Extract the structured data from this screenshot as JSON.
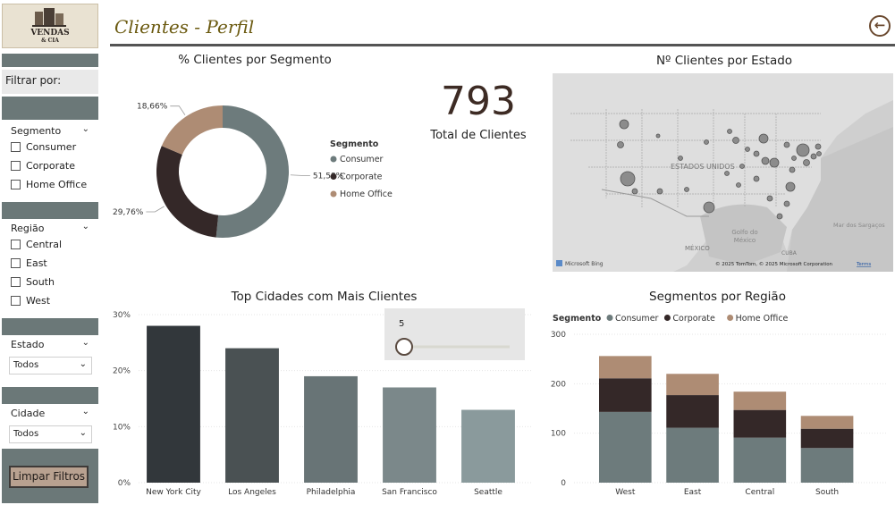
{
  "sidebar": {
    "logo_text_1": "VENDAS",
    "logo_text_2": "& CIA",
    "filter_label": "Filtrar por:",
    "segment_title": "Segmento",
    "segment_options": [
      "Consumer",
      "Corporate",
      "Home Office"
    ],
    "region_title": "Região",
    "region_options": [
      "Central",
      "East",
      "South",
      "West"
    ],
    "state_title": "Estado",
    "state_value": "Todos",
    "city_title": "Cidade",
    "city_value": "Todos",
    "clear_button": "Limpar Filtros"
  },
  "header": {
    "title": "Clientes - Perfil",
    "back_icon": "arrow-left-circle-icon"
  },
  "kpi": {
    "value": "793",
    "label": "Total de Clientes"
  },
  "donut": {
    "title": "% Clientes por Segmento",
    "legend_title": "Segmento"
  },
  "map": {
    "title": "Nº Clientes por Estado",
    "country_label": "ESTADOS UNIDOS",
    "gulf_label_1": "Golfo do",
    "gulf_label_2": "México",
    "mexico_label": "MÉXICO",
    "cuba_label": "CUBA",
    "sea_label": "Mar dos Sargaços",
    "bing_label": "Microsoft Bing",
    "copyright": "© 2025 TomTom, © 2025 Microsoft Corporation",
    "terms": "Terms"
  },
  "top_cities": {
    "title": "Top Cidades com Mais Clientes",
    "slider_value": "5",
    "slider_fraction": 0.0
  },
  "segments_region": {
    "title": "Segmentos por Região",
    "legend_title": "Segmento"
  },
  "colors": {
    "consumer": "#6d7b7c",
    "corporate": "#342828",
    "home_office": "#ae8c74",
    "title": "#6b5a10"
  },
  "chart_data": [
    {
      "type": "pie",
      "title": "% Clientes por Segmento",
      "legend_title": "Segmento",
      "categories": [
        "Consumer",
        "Corporate",
        "Home Office"
      ],
      "values": [
        51.58,
        29.76,
        18.66
      ],
      "labels": [
        "51,58%",
        "29,76%",
        "18,66%"
      ],
      "colors": [
        "#6d7b7c",
        "#342828",
        "#ae8c74"
      ]
    },
    {
      "type": "bar",
      "title": "Top Cidades com Mais Clientes",
      "categories": [
        "New York City",
        "Los Angeles",
        "Philadelphia",
        "San Francisco",
        "Seattle"
      ],
      "values": [
        0.28,
        0.24,
        0.19,
        0.17,
        0.13
      ],
      "colors": [
        "#32373b",
        "#4a5153",
        "#687476",
        "#7b888a",
        "#8a9a9c"
      ],
      "ylim": [
        0,
        0.3
      ],
      "yticks": [
        "0%",
        "10%",
        "20%",
        "30%"
      ]
    },
    {
      "type": "bar",
      "stacked": true,
      "title": "Segmentos por Região",
      "legend_title": "Segmento",
      "categories": [
        "West",
        "East",
        "Central",
        "South"
      ],
      "series": [
        {
          "name": "Consumer",
          "values": [
            143,
            111,
            91,
            70
          ]
        },
        {
          "name": "Corporate",
          "values": [
            68,
            66,
            56,
            39
          ]
        },
        {
          "name": "Home Office",
          "values": [
            45,
            43,
            37,
            26
          ]
        }
      ],
      "ylim": [
        0,
        300
      ],
      "yticks": [
        "0",
        "100",
        "200",
        "300"
      ]
    }
  ]
}
